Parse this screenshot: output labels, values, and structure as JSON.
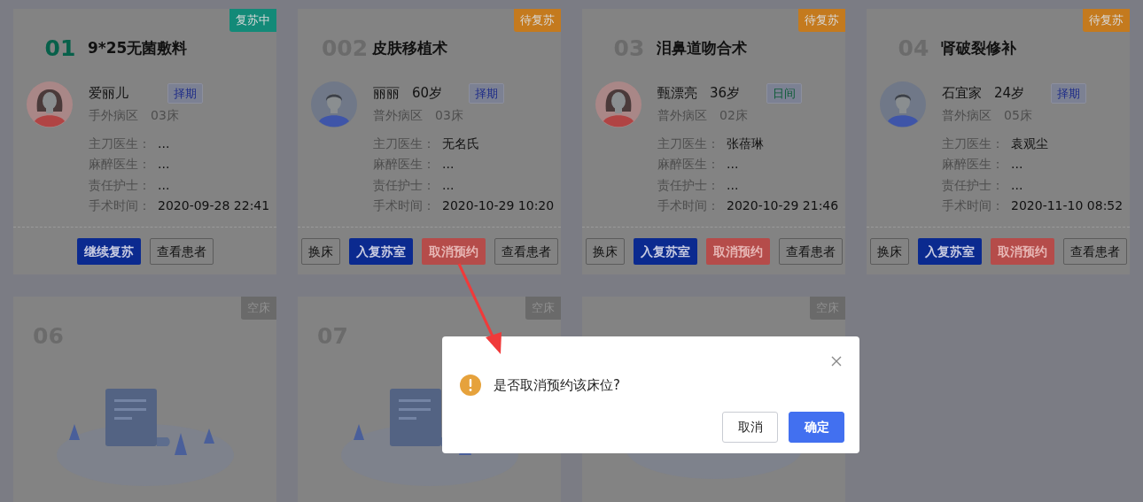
{
  "cards": [
    {
      "number": "01",
      "number_active": true,
      "title": "9*25无菌敷料",
      "status": {
        "label": "复苏中",
        "color": "#138a78"
      },
      "avatar": {
        "kind": "female"
      },
      "name": "爱丽儿",
      "tag": {
        "label": "择期",
        "color": "#1e2c88"
      },
      "ward": "手外病区",
      "bed": "03床",
      "fields": [
        {
          "label": "主刀医生：",
          "value": "..."
        },
        {
          "label": "麻醉医生：",
          "value": "..."
        },
        {
          "label": "责任护士：",
          "value": "..."
        },
        {
          "label": "手术时间：",
          "value": "2020-09-28 22:41"
        }
      ],
      "actions": [
        {
          "label": "继续复苏",
          "kind": "primary"
        },
        {
          "label": "查看患者",
          "kind": "outline"
        }
      ]
    },
    {
      "number": "002",
      "number_active": false,
      "title": "皮肤移植术",
      "status": {
        "label": "待复苏",
        "color": "#c47a1e"
      },
      "avatar": {
        "kind": "male"
      },
      "name": "丽丽",
      "age": "60岁",
      "tag": {
        "label": "择期",
        "color": "#1e2c88"
      },
      "ward": "普外病区",
      "bed": "03床",
      "fields": [
        {
          "label": "主刀医生：",
          "value": "无名氏"
        },
        {
          "label": "麻醉医生：",
          "value": "..."
        },
        {
          "label": "责任护士：",
          "value": "..."
        },
        {
          "label": "手术时间：",
          "value": "2020-10-29 10:20"
        }
      ],
      "actions": [
        {
          "label": "换床",
          "kind": "outline"
        },
        {
          "label": "入复苏室",
          "kind": "primary"
        },
        {
          "label": "取消预约",
          "kind": "danger"
        },
        {
          "label": "查看患者",
          "kind": "outline"
        }
      ]
    },
    {
      "number": "03",
      "number_active": false,
      "title": "泪鼻道吻合术",
      "status": {
        "label": "待复苏",
        "color": "#c47a1e"
      },
      "avatar": {
        "kind": "female"
      },
      "name": "甄漂亮",
      "age": "36岁",
      "tag": {
        "label": "日间",
        "color": "#0b5a36"
      },
      "ward": "普外病区",
      "bed": "02床",
      "fields": [
        {
          "label": "主刀医生：",
          "value": "张蓓琳"
        },
        {
          "label": "麻醉医生：",
          "value": "..."
        },
        {
          "label": "责任护士：",
          "value": "..."
        },
        {
          "label": "手术时间：",
          "value": "2020-10-29 21:46"
        }
      ],
      "actions": [
        {
          "label": "换床",
          "kind": "outline"
        },
        {
          "label": "入复苏室",
          "kind": "primary"
        },
        {
          "label": "取消预约",
          "kind": "danger"
        },
        {
          "label": "查看患者",
          "kind": "outline"
        }
      ]
    },
    {
      "number": "04",
      "number_active": false,
      "title": "肾破裂修补",
      "status": {
        "label": "待复苏",
        "color": "#c47a1e"
      },
      "avatar": {
        "kind": "male"
      },
      "name": "石宜家",
      "age": "24岁",
      "tag": {
        "label": "择期",
        "color": "#1e2c88"
      },
      "ward": "普外病区",
      "bed": "05床",
      "fields": [
        {
          "label": "主刀医生：",
          "value": "袁观尘"
        },
        {
          "label": "麻醉医生：",
          "value": "..."
        },
        {
          "label": "责任护士：",
          "value": "..."
        },
        {
          "label": "手术时间：",
          "value": "2020-11-10 08:52"
        }
      ],
      "actions": [
        {
          "label": "换床",
          "kind": "outline"
        },
        {
          "label": "入复苏室",
          "kind": "primary"
        },
        {
          "label": "取消预约",
          "kind": "danger"
        },
        {
          "label": "查看患者",
          "kind": "outline"
        }
      ]
    }
  ],
  "empty_beds": [
    {
      "number": "06",
      "status": "空床"
    },
    {
      "number": "07",
      "status": "空床"
    },
    {
      "status": "空床"
    }
  ],
  "dialog": {
    "message": "是否取消预约该床位?",
    "buttons": [
      {
        "label": "取消",
        "kind": "default"
      },
      {
        "label": "确定",
        "kind": "primary"
      }
    ]
  }
}
